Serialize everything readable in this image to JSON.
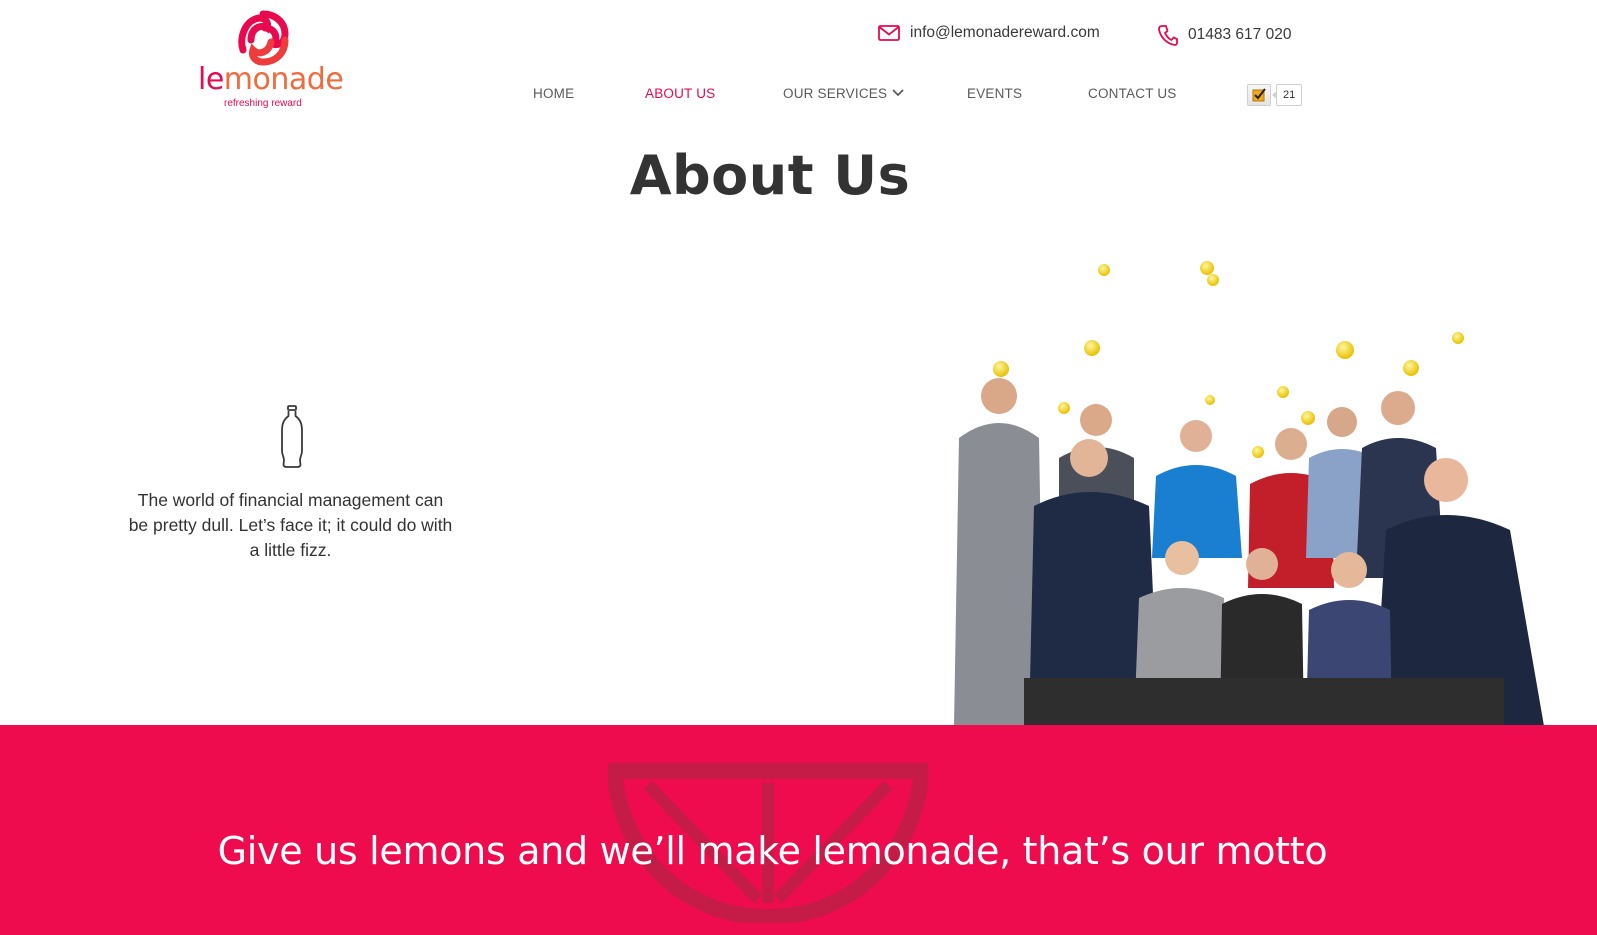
{
  "logo": {
    "word_part1": "le",
    "word_part2": "monade",
    "tagline": "refreshing reward"
  },
  "contact": {
    "email": "info@lemonadereward.com",
    "phone": "01483 617 020"
  },
  "nav": {
    "items": [
      {
        "label": "HOME",
        "active": false
      },
      {
        "label": "ABOUT US",
        "active": true
      },
      {
        "label": "OUR SERVICES",
        "active": false
      },
      {
        "label": "EVENTS",
        "active": false
      },
      {
        "label": "CONTACT US",
        "active": false
      }
    ]
  },
  "badge": {
    "count": "21",
    "icon": "checkbox-icon"
  },
  "page": {
    "title": "About Us"
  },
  "intro": {
    "icon": "bottle-icon",
    "text": "The world of financial management can be pretty dull. Let’s face it; it could do with a little fizz."
  },
  "motto": {
    "text": "Give us lemons and we’ll make lemonade, that’s our motto"
  },
  "colors": {
    "brand": "#e8094e",
    "brand_orange": "#f06b3d",
    "band": "#ee0b4e",
    "text": "#333333"
  }
}
